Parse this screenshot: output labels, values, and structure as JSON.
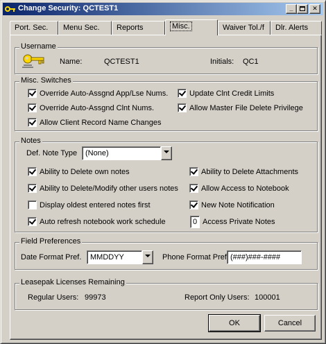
{
  "window": {
    "title": "Change Security: QCTEST1"
  },
  "tabs": [
    {
      "label": "Port. Sec."
    },
    {
      "label": "Menu Sec."
    },
    {
      "label": "Reports"
    },
    {
      "label": "Misc."
    },
    {
      "label": "Waiver Tol./f"
    },
    {
      "label": "Dlr. Alerts"
    }
  ],
  "active_tab": "Misc.",
  "username": {
    "group_title": "Username",
    "name_label": "Name:",
    "name_value": "QCTEST1",
    "initials_label": "Initials:",
    "initials_value": "QC1"
  },
  "misc": {
    "group_title": "Misc. Switches",
    "items": [
      {
        "label": "Override Auto-Assgnd App/Lse Nums.",
        "checked": true
      },
      {
        "label": "Update Clnt Credit Limits",
        "checked": true
      },
      {
        "label": "Override Auto-Assgnd Clnt Nums.",
        "checked": true
      },
      {
        "label": "Allow Master File Delete Privilege",
        "checked": true
      },
      {
        "label": "Allow Client Record Name Changes",
        "checked": true
      }
    ]
  },
  "notes": {
    "group_title": "Notes",
    "def_type_label": "Def. Note Type",
    "def_type_value": "(None)",
    "items": [
      {
        "label": "Ability to Delete own notes",
        "checked": true
      },
      {
        "label": "Ability to Delete Attachments",
        "checked": true
      },
      {
        "label": "Ability to Delete/Modify other users notes",
        "checked": true
      },
      {
        "label": "Allow Access to Notebook",
        "checked": true
      },
      {
        "label": "Display oldest entered notes first",
        "checked": false
      },
      {
        "label": "New Note Notification",
        "checked": true
      },
      {
        "label": "Auto refresh notebook work schedule",
        "checked": true
      }
    ],
    "private_count": "0",
    "private_label": "Access Private Notes"
  },
  "field_prefs": {
    "group_title": "Field Preferences",
    "date_label": "Date Format Pref.",
    "date_value": "MMDDYY",
    "phone_label": "Phone Format Pref.",
    "phone_value": "(###)###-####"
  },
  "licenses": {
    "group_title": "Leasepak Licenses Remaining",
    "regular_label": "Regular Users:",
    "regular_value": "99973",
    "report_label": "Report Only Users:",
    "report_value": "100001"
  },
  "buttons": {
    "ok": "OK",
    "cancel": "Cancel"
  },
  "colors": {
    "titlebar_start": "#0a246a",
    "titlebar_end": "#a6caf0",
    "face": "#d4d0c8"
  }
}
